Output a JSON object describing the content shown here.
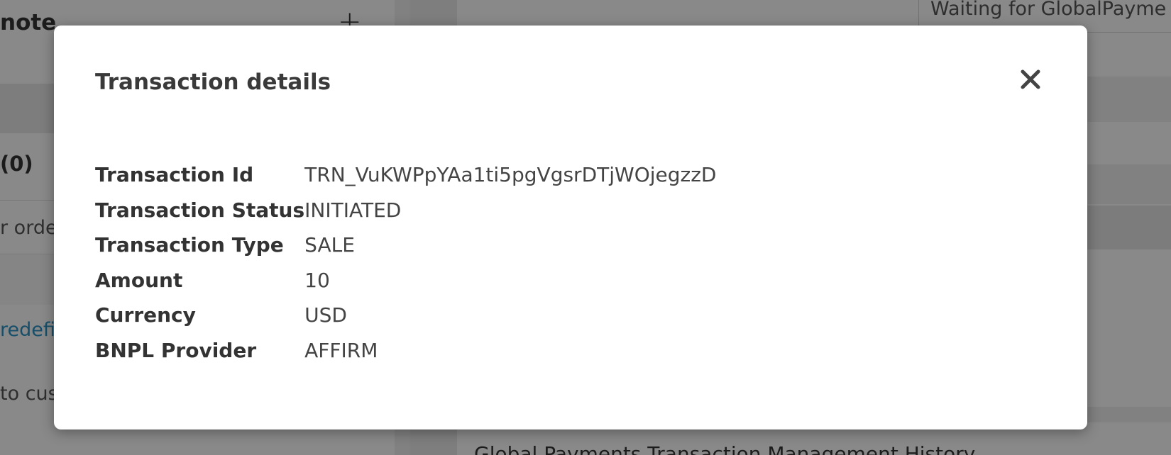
{
  "background": {
    "left_panel": {
      "title": "note",
      "count": "(0)",
      "order_text": "r orde",
      "link_text": "redefi",
      "cust_text": "to cus"
    },
    "right_panel": {
      "status_cell": "Waiting for GlobalPayme",
      "footer_text": "Global Payments Transaction Management History"
    }
  },
  "modal": {
    "title": "Transaction details",
    "close_label": "Close",
    "rows": [
      {
        "label": "Transaction Id",
        "value": "TRN_VuKWPpYAa1ti5pgVgsrDTjWOjegzzD"
      },
      {
        "label": "Transaction Status",
        "value": "INITIATED"
      },
      {
        "label": "Transaction Type",
        "value": "SALE"
      },
      {
        "label": "Amount",
        "value": "10"
      },
      {
        "label": "Currency",
        "value": "USD"
      },
      {
        "label": "BNPL Provider",
        "value": "AFFIRM"
      }
    ]
  },
  "colors": {
    "overlay": "#000000",
    "modal_background": "#ffffff",
    "label_text": "#333333",
    "value_text": "#444444",
    "link": "#2b8fc0"
  },
  "icons": {
    "close": "close-icon",
    "add": "plus-icon"
  }
}
